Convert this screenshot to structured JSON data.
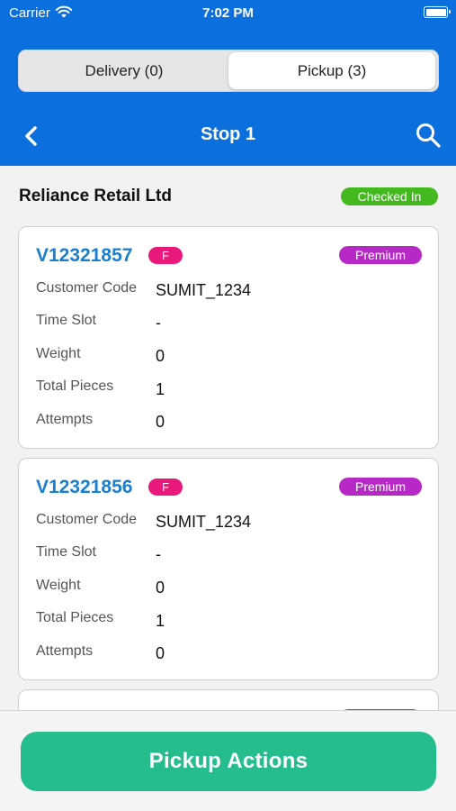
{
  "status_bar": {
    "carrier": "Carrier",
    "time": "7:02 PM"
  },
  "tabs": [
    {
      "label": "Delivery (0)",
      "selected": false
    },
    {
      "label": "Pickup (3)",
      "selected": true
    }
  ],
  "nav": {
    "title": "Stop 1"
  },
  "store": {
    "name": "Reliance Retail Ltd",
    "status": "Checked In"
  },
  "labels": {
    "customer_code": "Customer Code",
    "time_slot": "Time Slot",
    "weight": "Weight",
    "total_pieces": "Total Pieces",
    "attempts": "Attempts"
  },
  "shipments": [
    {
      "id": "V12321857",
      "type_badge": "F",
      "tier": "Premium",
      "customer_code": "SUMIT_1234",
      "time_slot": "-",
      "weight": "0",
      "total_pieces": "1",
      "attempts": "0"
    },
    {
      "id": "V12321856",
      "type_badge": "F",
      "tier": "Premium",
      "customer_code": "SUMIT_1234",
      "time_slot": "-",
      "weight": "0",
      "total_pieces": "1",
      "attempts": "0"
    }
  ],
  "footer": {
    "action_label": "Pickup Actions"
  },
  "colors": {
    "header_blue": "#0b6fde",
    "checked_in_green": "#43b81f",
    "f_badge_pink": "#e8197a",
    "premium_purple": "#b629c7",
    "action_green": "#26bd8e",
    "id_blue": "#1a7fcf"
  },
  "icons": {
    "back": "chevron-left-icon",
    "search": "search-icon",
    "wifi": "wifi-icon",
    "battery": "battery-icon"
  }
}
